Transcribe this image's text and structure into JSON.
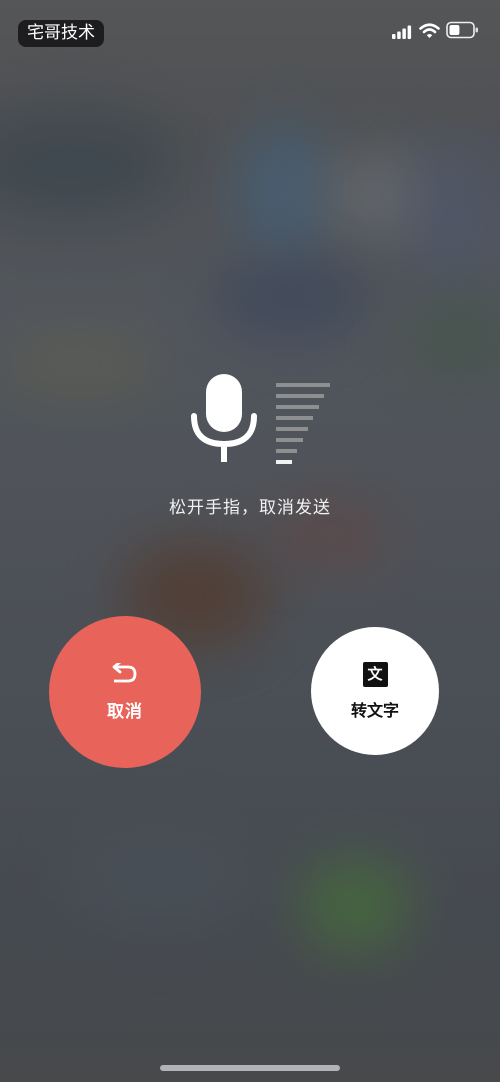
{
  "status_bar": {
    "app_name": "宅哥技术",
    "icons": [
      "signal-icon",
      "wifi-icon",
      "battery-icon"
    ],
    "battery_level": 0.45
  },
  "recording": {
    "mic_icon": "microphone-icon",
    "volume_level_icon": "volume-level-icon",
    "hint": "松开手指，取消发送"
  },
  "actions": {
    "cancel": {
      "label": "取消",
      "icon": "undo-arrow-icon",
      "color": "#e8635a"
    },
    "convert_to_text": {
      "label": "转文字",
      "icon_text": "文",
      "icon": "text-icon",
      "color": "#ffffff"
    }
  }
}
